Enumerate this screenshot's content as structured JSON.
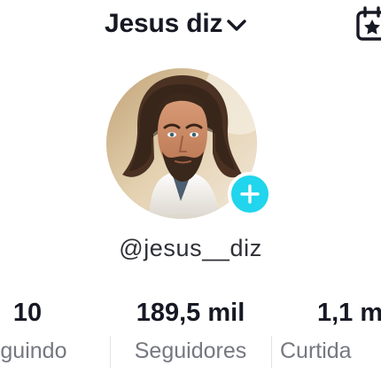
{
  "header": {
    "title": "Jesus diz",
    "dropdown_icon": "chevron-down-icon",
    "right_icon": "calendar-star-icon"
  },
  "profile": {
    "avatar_description": "profile photo",
    "add_icon": "plus-icon",
    "username": "@jesus__diz",
    "colors": {
      "accent": "#20d5ec",
      "primary_text": "#161823",
      "secondary_text": "#767880"
    }
  },
  "stats": [
    {
      "value": "10",
      "label": "eguindo"
    },
    {
      "value": "189,5 mil",
      "label": "Seguidores"
    },
    {
      "value": "1,1 m",
      "label": "Curtida"
    }
  ]
}
